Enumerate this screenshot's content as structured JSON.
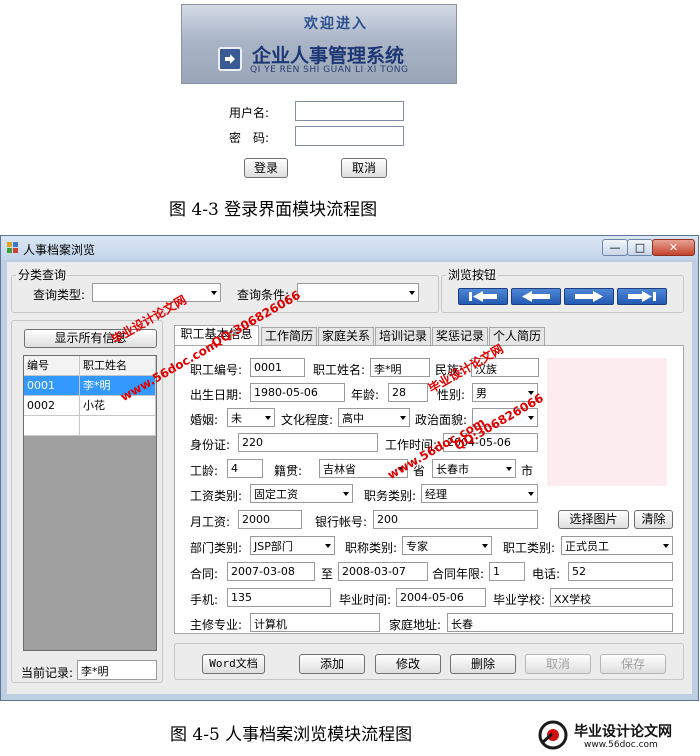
{
  "login": {
    "banner_welcome": "欢迎进入",
    "banner_title": "企业人事管理系统",
    "banner_pinyin": "QI YE REN SHI GUAN LI XI TONG",
    "username_label": "用户名:",
    "password_label": "密　码:",
    "login_button": "登录",
    "cancel_button": "取消"
  },
  "captions": {
    "login_caption": "图 4-3 登录界面模块流程图",
    "browse_caption": "图 4-5 人事档案浏览模块流程图"
  },
  "window": {
    "title": "人事档案浏览",
    "min_glyph": "—",
    "max_glyph": "□",
    "close_glyph": "✕"
  },
  "classify": {
    "group_title": "分类查询",
    "query_type_label": "查询类型:",
    "query_value_label": "查询条件:"
  },
  "browse_group": {
    "title": "浏览按钮"
  },
  "left": {
    "show_all_button": "显示所有信息",
    "grid_headers": [
      "编号",
      "职工姓名"
    ],
    "rows": [
      {
        "id": "0001",
        "name": "李*明"
      },
      {
        "id": "0002",
        "name": "小花"
      }
    ],
    "current_record_label": "当前记录:",
    "current_record_value": "李*明"
  },
  "tabs": [
    "职工基本信息",
    "工作简历",
    "家庭关系",
    "培训记录",
    "奖惩记录",
    "个人简历"
  ],
  "form": {
    "emp_id_label": "职工编号:",
    "emp_id": "0001",
    "emp_name_label": "职工姓名:",
    "emp_name": "李*明",
    "nation_label": "民族:",
    "nation": "汉族",
    "birth_label": "出生日期:",
    "birth": "1980-05-06",
    "age_label": "年龄:",
    "age": "28",
    "sex_label": "性别:",
    "sex": "男",
    "marriage_label": "婚姻:",
    "marriage": "未",
    "edu_label": "文化程度:",
    "edu": "高中",
    "politics_label": "政治面貌:",
    "politics": "",
    "idcard_label": "身份证:",
    "idcard": "220",
    "work_time_label": "工作时间:",
    "work_time": "2004-05-06",
    "seniority_label": "工龄:",
    "seniority": "4",
    "native_label": "籍贯:",
    "native_province": "吉林省",
    "province_suffix": "省",
    "native_city": "长春市",
    "city_suffix": "市",
    "wage_type_label": "工资类别:",
    "wage_type": "固定工资",
    "post_type_label": "职务类别:",
    "post_type": "经理",
    "salary_label": "月工资:",
    "salary": "2000",
    "bank_label": "银行帐号:",
    "bank": "200",
    "choose_photo_button": "选择图片",
    "clear_photo_button": "清除",
    "dept_label": "部门类别:",
    "dept": "JSP部门",
    "title_type_label": "职称类别:",
    "title_type": "专家",
    "emp_type_label": "职工类别:",
    "emp_type": "正式员工",
    "contract_label": "合同:",
    "contract_start": "2007-03-08",
    "to_label": "至",
    "contract_end": "2008-03-07",
    "contract_years_label": "合同年限:",
    "contract_years": "1",
    "phone_label": "电话:",
    "phone": "52",
    "mobile_label": "手机:",
    "mobile": "135",
    "grad_time_label": "毕业时间:",
    "grad_time": "2004-05-06",
    "school_label": "毕业学校:",
    "school": "XX学校",
    "major_label": "主修专业:",
    "major": "计算机",
    "address_label": "家庭地址:",
    "address": "长春"
  },
  "actions": {
    "word_button": "Word文档",
    "add_button": "添加",
    "edit_button": "修改",
    "delete_button": "删除",
    "cancel_button": "取消",
    "save_button": "保存"
  },
  "watermarks": {
    "site": "www.56doc.com",
    "qq": "QQ:306826066",
    "brand": "毕业设计论文网",
    "footer_brand": "毕业设计论文网",
    "footer_site": "www.56doc.com"
  },
  "colors": {
    "nav_button": "#2e6cc8",
    "watermark_red": "#e00000",
    "selected_row": "#3399ff",
    "photo_box": "#fcecef"
  }
}
